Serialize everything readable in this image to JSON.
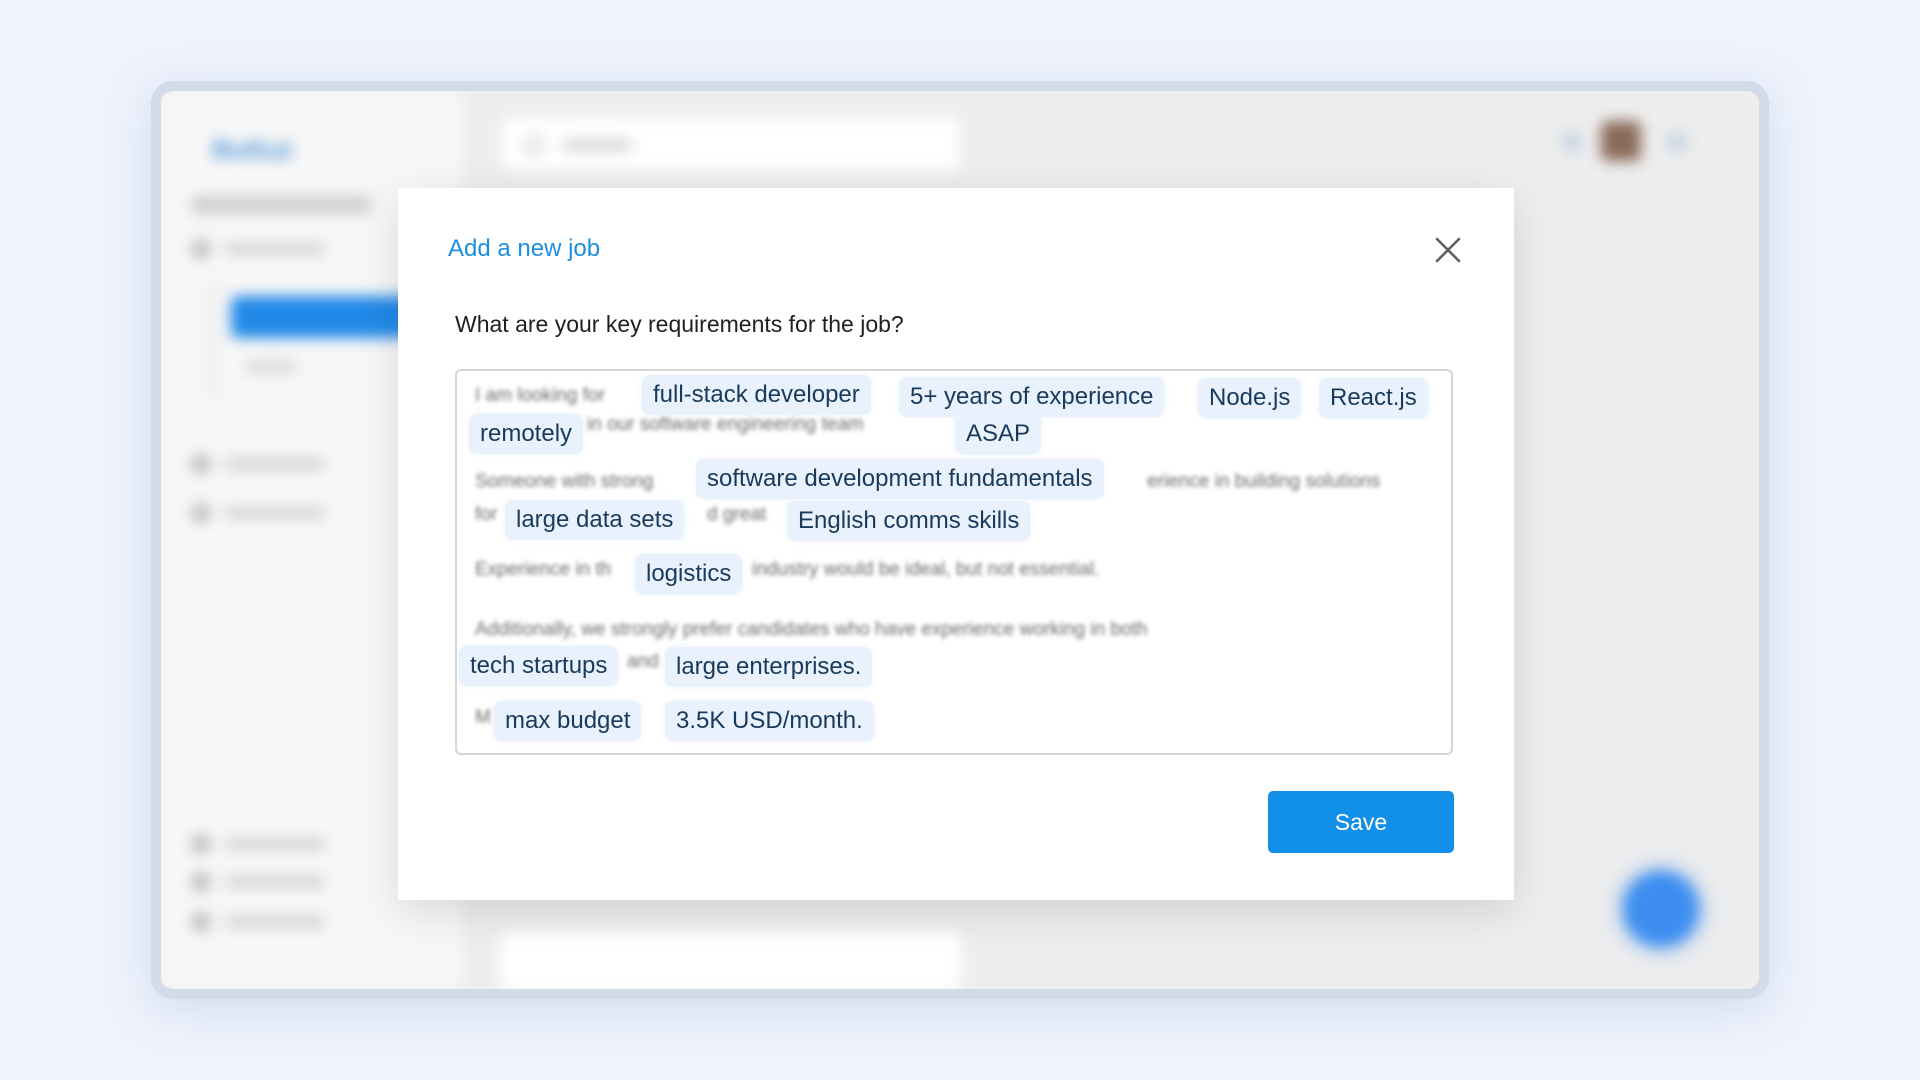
{
  "background_app": {
    "logo": "Bolt",
    "logo_suffix": "ai",
    "search_placeholder": "Search"
  },
  "modal": {
    "title": "Add a new job",
    "question": "What are your key requirements for the job?",
    "text_lines": {
      "l1": "I am looking for",
      "l2": "in our software engineering team",
      "l3": "Someone with strong",
      "l4": "erience in building solutions",
      "l5": "for",
      "l6": "d great",
      "l7": "Experience in th",
      "l8": "industry would be ideal, but not essential.",
      "l9": "Additionally, we strongly prefer candidates who have experience working in both",
      "l10": "and",
      "l11": "M"
    },
    "tags": {
      "t1": "full-stack developer",
      "t2": "5+ years of experience",
      "t3": "Node.js",
      "t4": "React.js",
      "t5": "remotely",
      "t6": "ASAP",
      "t7": "software development fundamentals",
      "t8": "large data sets",
      "t9": "English comms skills",
      "t10": "logistics",
      "t11": "tech startups",
      "t12": "large enterprises.",
      "t13": "max budget",
      "t14": "3.5K USD/month."
    },
    "save_label": "Save"
  }
}
